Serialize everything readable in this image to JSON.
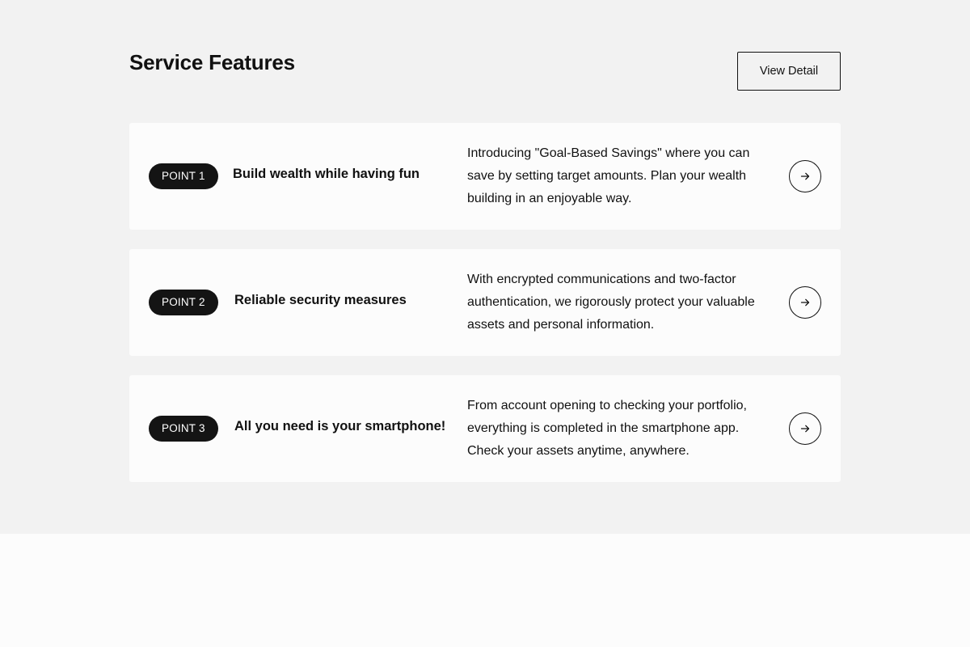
{
  "section": {
    "title": "Service Features",
    "view_detail_label": "View Detail"
  },
  "features": [
    {
      "badge": "POINT 1",
      "title": "Build wealth while having fun",
      "description": "Introducing \"Goal-Based Savings\" where you can save by setting target amounts. Plan your wealth building in an enjoyable way.",
      "action_icon": "arrow-right-icon"
    },
    {
      "badge": "POINT 2",
      "title": "Reliable security measures",
      "description": "With encrypted communications and two-factor authentication, we rigorously protect your valuable assets and personal information.",
      "action_icon": "arrow-right-icon"
    },
    {
      "badge": "POINT 3",
      "title": "All you need is your smartphone!",
      "description": "From account opening to checking your portfolio, everything is completed in the smartphone app. Check your assets anytime, anywhere.",
      "action_icon": "arrow-right-icon"
    }
  ],
  "colors": {
    "section_bg": "#f2f2f2",
    "card_bg": "#fcfcfc",
    "badge_bg": "#141414",
    "text": "#111111"
  }
}
